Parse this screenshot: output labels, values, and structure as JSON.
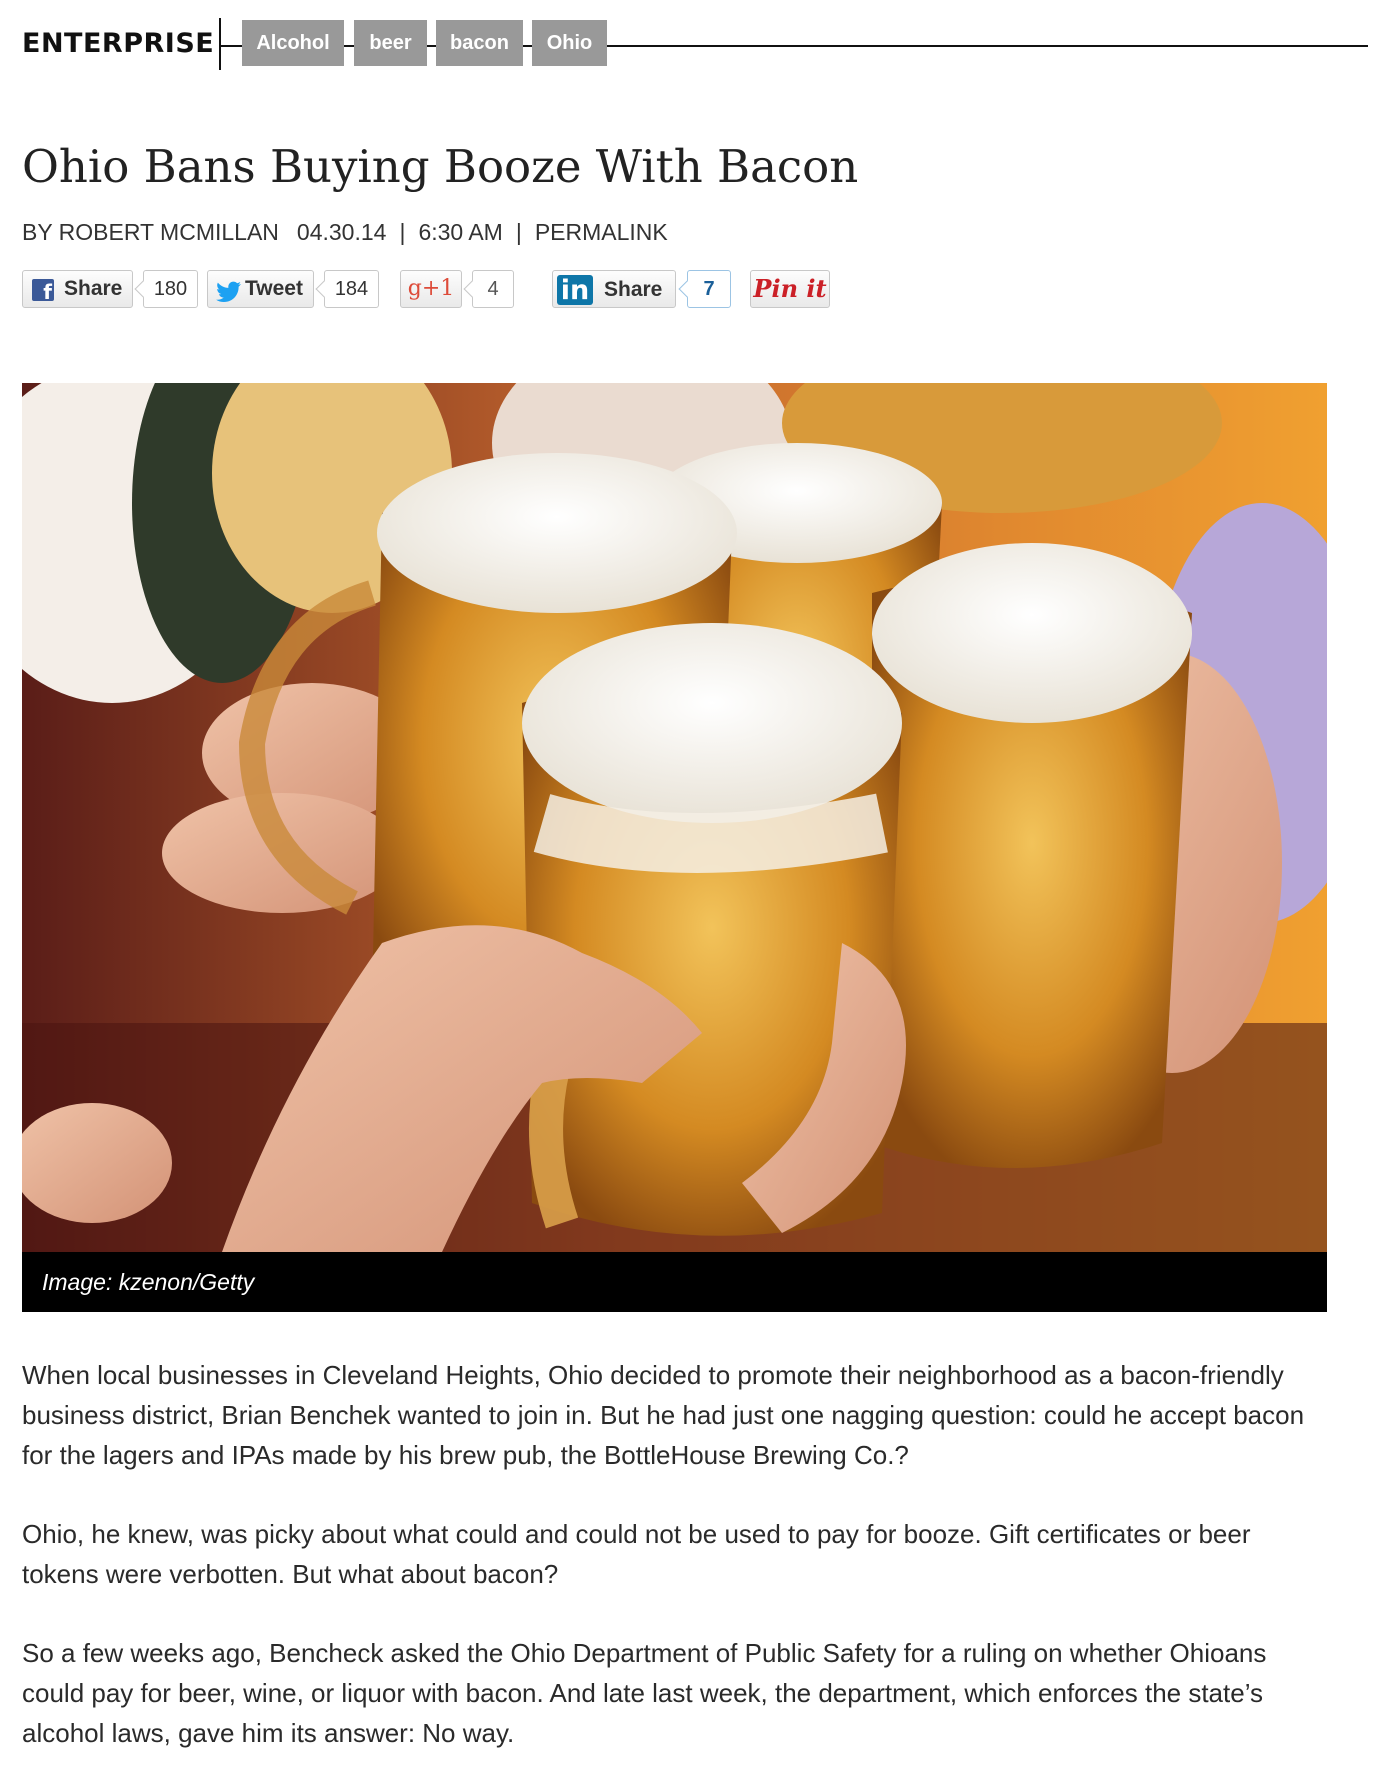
{
  "header": {
    "section": "ENTERPRISE",
    "tags": [
      "Alcohol",
      "beer",
      "bacon",
      "Ohio"
    ]
  },
  "article": {
    "title": "Ohio Bans Buying Booze With Bacon",
    "byline": {
      "author": "BY ROBERT MCMILLAN",
      "date": "04.30.14",
      "time": "6:30 AM",
      "separator": "|",
      "permalink": "PERMALINK"
    },
    "share": {
      "facebook": {
        "label": "Share",
        "count": "180",
        "icon": "facebook-icon"
      },
      "twitter": {
        "label": "Tweet",
        "count": "184",
        "icon": "twitter-bird-icon"
      },
      "googleplus": {
        "label": "g+1",
        "count": "4",
        "icon": "google-plus-icon"
      },
      "linkedin": {
        "label": "Share",
        "icon_text": "in",
        "count": "7",
        "icon": "linkedin-icon"
      },
      "pinterest": {
        "label": "Pin it"
      }
    },
    "image": {
      "caption": "Image: kzenon/Getty"
    },
    "paragraphs": [
      "When local businesses in Cleveland Heights, Ohio decided to promote their neighborhood as a bacon-friendly business district, Brian Benchek wanted to join in. But he had just one nagging question: could he accept bacon for the lagers and IPAs made by his brew pub, the BottleHouse Brewing Co.?",
      "Ohio, he knew, was picky about what could and could not be used to pay for booze. Gift certificates or beer tokens were verbotten. But what about bacon?",
      "So a few weeks ago, Bencheck asked the Ohio Department of Public Safety for a ruling on whether Ohioans could pay for beer, wine, or liquor with bacon. And late last week, the department, which enforces the state’s alcohol laws, gave him its answer: No way."
    ]
  },
  "colors": {
    "tag_bg": "#999999",
    "facebook": "#3b5998",
    "twitter": "#1da1f2",
    "googleplus": "#dd4b39",
    "linkedin": "#0e76a8",
    "pinterest": "#cb2027"
  }
}
